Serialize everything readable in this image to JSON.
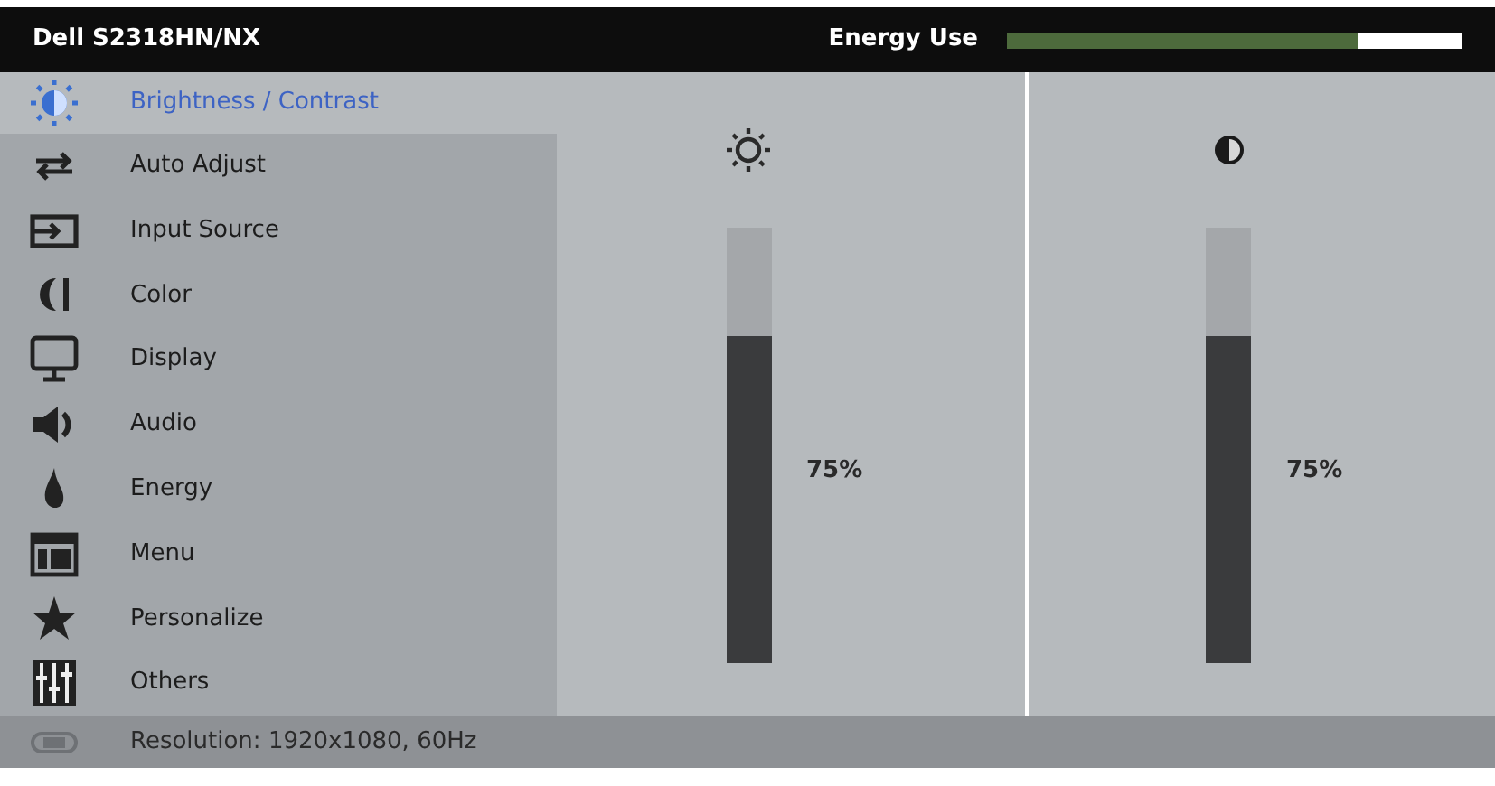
{
  "header": {
    "title": "Dell S2318HN/NX",
    "energy": {
      "label": "Energy Use",
      "level": 0.77
    }
  },
  "menu": [
    {
      "kind": "brightness",
      "label": "Brightness / Contrast",
      "selected": true
    },
    {
      "kind": "auto",
      "label": "Auto Adjust",
      "selected": false
    },
    {
      "kind": "input",
      "label": "Input Source",
      "selected": false
    },
    {
      "kind": "color",
      "label": "Color",
      "selected": false
    },
    {
      "kind": "display",
      "label": "Display",
      "selected": false
    },
    {
      "kind": "audio",
      "label": "Audio",
      "selected": false
    },
    {
      "kind": "energy",
      "label": "Energy",
      "selected": false
    },
    {
      "kind": "menu",
      "label": "Menu",
      "selected": false
    },
    {
      "kind": "personalize",
      "label": "Personalize",
      "selected": false
    },
    {
      "kind": "others",
      "label": "Others",
      "selected": false
    }
  ],
  "sliders": [
    {
      "kind": "brightness",
      "level": 0.75,
      "reading": "75%"
    },
    {
      "kind": "contrast",
      "level": 0.75,
      "reading": "75%"
    }
  ],
  "status_bar": {
    "text": "Resolution: 1920x1080, 60Hz"
  }
}
